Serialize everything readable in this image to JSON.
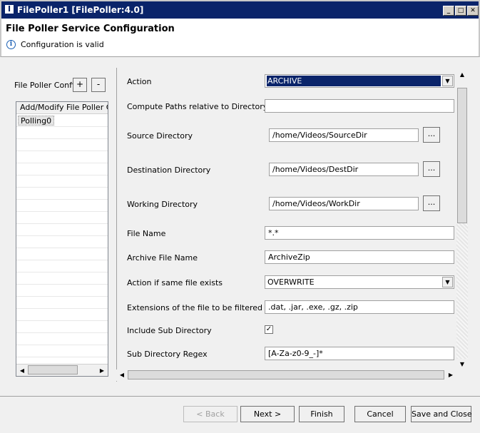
{
  "window": {
    "title": "FilePoller1 [FilePoller:4.0]",
    "app_icon": "I"
  },
  "header": {
    "title": "File Poller Service Configuration",
    "status_message": "Configuration is valid",
    "info_icon": "i"
  },
  "left_panel": {
    "label": "File Poller Confi",
    "add_label": "+",
    "remove_label": "-",
    "column_header": "Add/Modify File Poller Con",
    "items": [
      "Polling0"
    ]
  },
  "form": {
    "action": {
      "label": "Action",
      "value": "ARCHIVE"
    },
    "compute_paths": {
      "label": "Compute Paths relative to Directory",
      "value": ""
    },
    "source_dir": {
      "label": "Source Directory",
      "value": "/home/Videos/SourceDir"
    },
    "dest_dir": {
      "label": "Destination Directory",
      "value": "/home/Videos/DestDir"
    },
    "work_dir": {
      "label": "Working Directory",
      "value": "/home/Videos/WorkDir"
    },
    "file_name": {
      "label": "File Name",
      "value": "*.*"
    },
    "archive_file_name": {
      "label": "Archive File Name",
      "value": "ArchiveZip"
    },
    "same_file_action": {
      "label": "Action if same file exists",
      "value": "OVERWRITE"
    },
    "extensions": {
      "label": "Extensions of the file to be filtered",
      "value": ".dat, .jar, .exe, .gz, .zip"
    },
    "include_subdir": {
      "label": "Include Sub Directory",
      "checked": true
    },
    "subdir_regex": {
      "label": "Sub Directory Regex",
      "value": "[A-Za-z0-9_-]*"
    },
    "browse_label": "..."
  },
  "buttons": {
    "back": "< Back",
    "next": "Next >",
    "finish": "Finish",
    "cancel": "Cancel",
    "save_close": "Save and Close"
  },
  "colors": {
    "titlebar": "#0a246a",
    "selection": "#0a246a"
  }
}
